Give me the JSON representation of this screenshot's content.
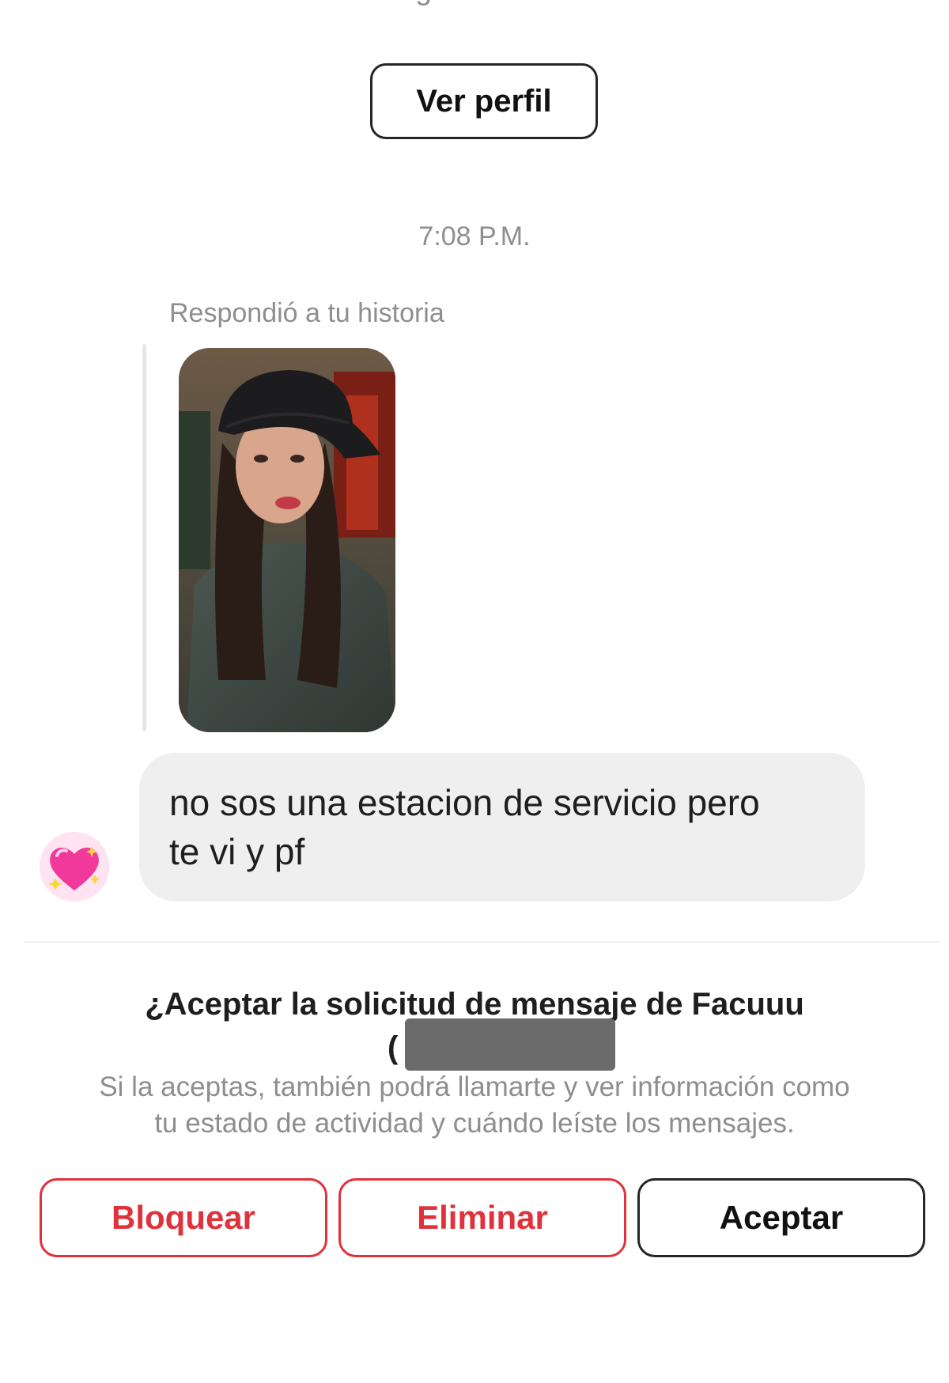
{
  "top_fragment": "Ambos siguen a Isolinesco.",
  "profile": {
    "view_profile_label": "Ver perfil"
  },
  "conversation": {
    "timestamp": "7:08 P.M.",
    "story_reply_label": "Respondió a tu historia",
    "story_thumbnail": "story-photo",
    "message_lines": [
      "no sos una estacion de servicio pero",
      "te vi y pf"
    ],
    "sender_avatar_icon": "sparkling-heart-icon"
  },
  "request": {
    "title": "¿Aceptar la solicitud de mensaje de Facuuu",
    "handle_prefix": "(",
    "description_lines": [
      "Si la aceptas, también podrá llamarte y ver información como",
      "tu estado de actividad y cuándo leíste los mensajes."
    ]
  },
  "actions": {
    "block_label": "Bloquear",
    "delete_label": "Eliminar",
    "accept_label": "Aceptar"
  },
  "colors": {
    "danger": "#e0323c",
    "bubble": "#efefef",
    "muted_text": "#8e8e8e"
  }
}
